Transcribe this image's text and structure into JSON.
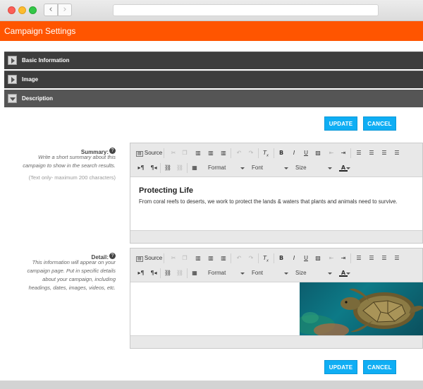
{
  "header": {
    "title": "Campaign Settings"
  },
  "sections": [
    {
      "label": "Basic Information",
      "open": false
    },
    {
      "label": "Image",
      "open": false
    },
    {
      "label": "Description",
      "open": true
    }
  ],
  "actions": {
    "update_label": "UPDATE",
    "cancel_label": "CANCEL"
  },
  "summary": {
    "label": "Summary:",
    "description": [
      "Write a short summary about this",
      "campaign to show in the search results."
    ],
    "note": "(Text only- maximum 200 characters)",
    "heading": "Protecting Life",
    "text": "From coral reefs to deserts, we work to protect the lands & waters that plants and animals need to survive."
  },
  "detail": {
    "label": "Detail:",
    "description": [
      "This information will appear on your",
      "campaign page. Put in specific details",
      "about your campaign, including",
      "headings, dates, images, videos, etc."
    ]
  },
  "toolbar": {
    "source_label": "Source",
    "format_label": "Format",
    "font_label": "Font",
    "size_label": "Size"
  },
  "icons": {
    "help": "?",
    "underline": "U",
    "bold": "B",
    "italic": "I",
    "font_color": "A"
  },
  "colors": {
    "accent": "#ff5500",
    "button": "#0faef4",
    "section": "#3d3d3d"
  }
}
